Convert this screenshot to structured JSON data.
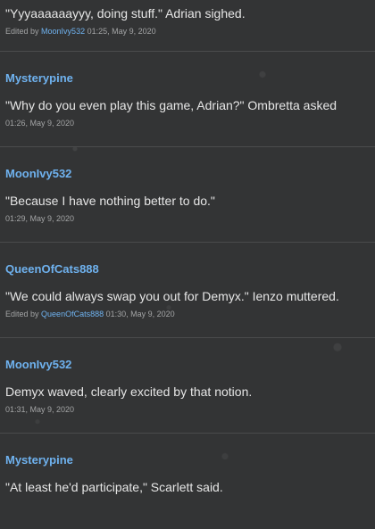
{
  "posts": [
    {
      "text": "\"Yyyaaaaaayyy, doing stuff.\" Adrian sighed.",
      "edited_prefix": "Edited by",
      "editor": "MoonIvy532",
      "timestamp": "01:25, May 9, 2020"
    },
    {
      "author": "Mysterypine",
      "text": "\"Why do you even play this game, Adrian?\" Ombretta asked",
      "timestamp": "01:26, May 9, 2020"
    },
    {
      "author": "MoonIvy532",
      "text": "\"Because I have nothing better to do.\"",
      "timestamp": "01:29, May 9, 2020"
    },
    {
      "author": "QueenOfCats888",
      "text": "\"We could always swap you out for Demyx.\" Ienzo muttered.",
      "edited_prefix": "Edited by",
      "editor": "QueenOfCats888",
      "timestamp": "01:30, May 9, 2020"
    },
    {
      "author": "MoonIvy532",
      "text": "Demyx waved, clearly excited by that notion.",
      "timestamp": "01:31, May 9, 2020"
    },
    {
      "author": "Mysterypine",
      "text": "\"At least he'd participate,\" Scarlett said."
    }
  ],
  "colors": {
    "background": "#333435",
    "author": "#6fb2ef",
    "text": "#e6e6e6",
    "meta": "#a3a4a5"
  }
}
